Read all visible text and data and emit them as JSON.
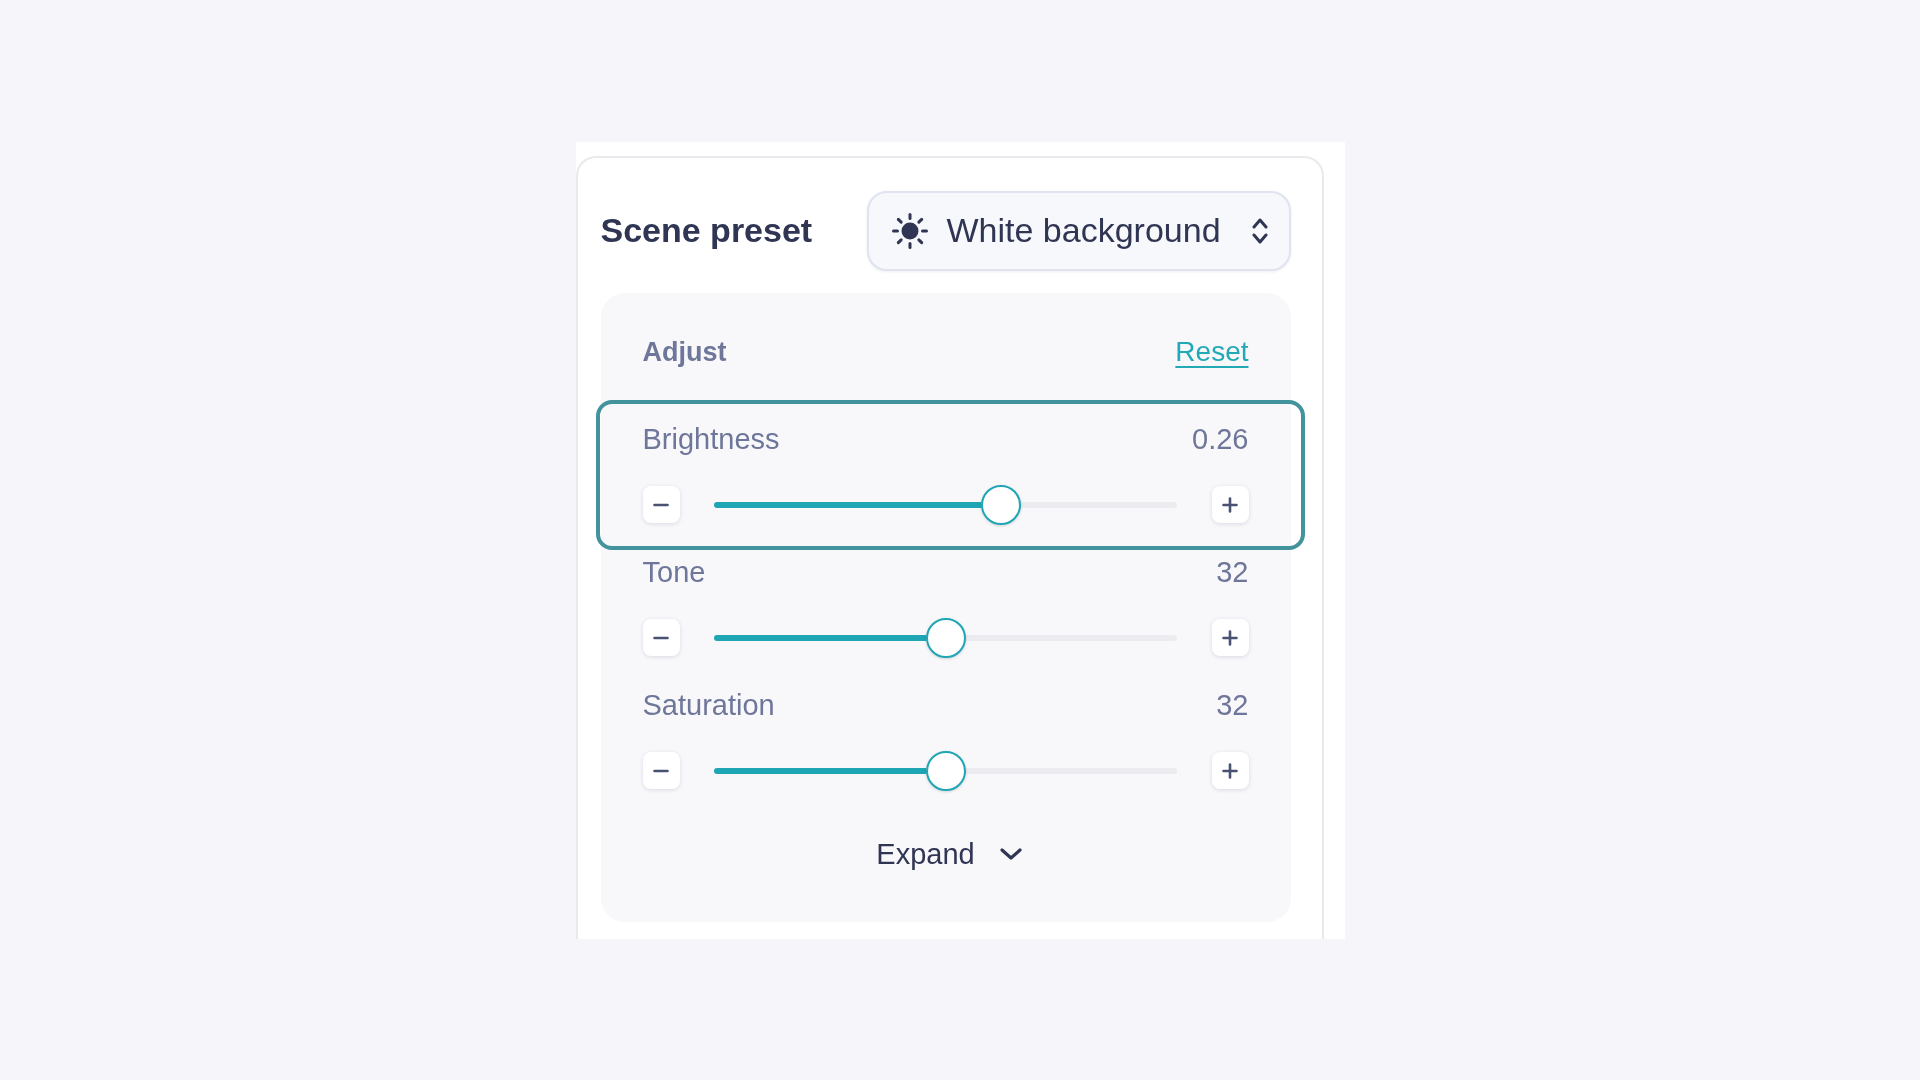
{
  "scene_preset": {
    "label": "Scene preset",
    "select": {
      "value": "White background"
    }
  },
  "adjust": {
    "title": "Adjust",
    "reset_link": "Reset",
    "sliders": [
      {
        "label": "Brightness",
        "reading": "0.26",
        "level": 0.62,
        "focused": true
      },
      {
        "label": "Tone",
        "reading": "32",
        "level": 0.5,
        "focused": false
      },
      {
        "label": "Saturation",
        "reading": "32",
        "level": 0.5,
        "focused": false
      }
    ],
    "expand_button": "Expand"
  }
}
